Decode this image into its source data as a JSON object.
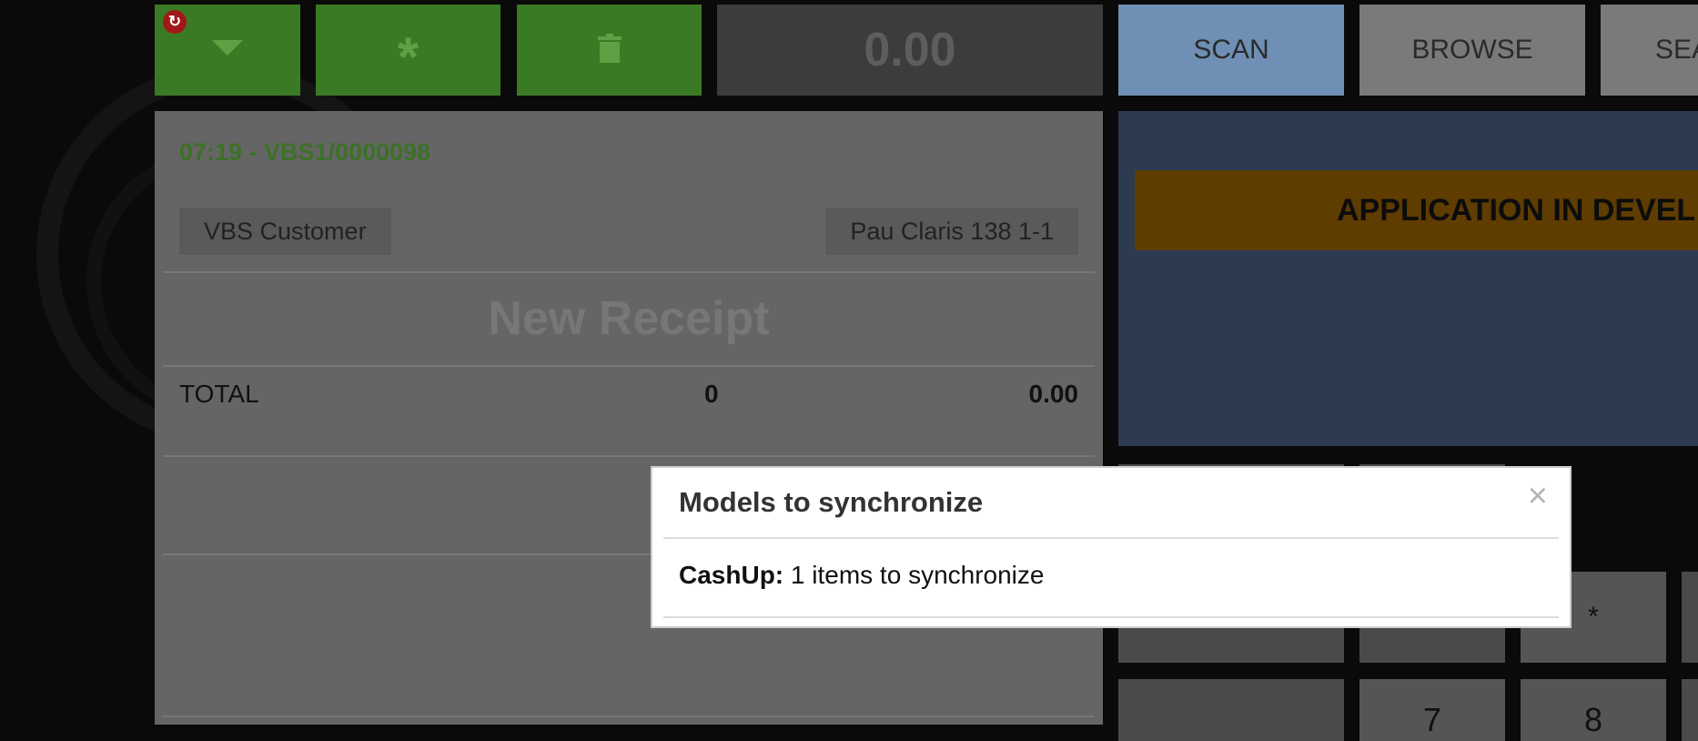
{
  "toolbar": {
    "menu_icon": "caret-down-icon",
    "sync_badge_icon": "sync-icon",
    "asterisk_label": "*",
    "delete_icon": "trash-icon",
    "amount": "0.00",
    "tabs": {
      "scan": "SCAN",
      "browse": "BROWSE",
      "search": "SEA"
    }
  },
  "receipt": {
    "header": "07:19 - VBS1/0000098",
    "customer": "VBS Customer",
    "address": "Pau Claris 138 1-1",
    "title": "New Receipt",
    "total_label": "TOTAL",
    "total_count": "0",
    "total_amount": "0.00"
  },
  "right_panel": {
    "banner": "APPLICATION IN DEVEL"
  },
  "keypad": {
    "asterisk": "*",
    "seven": "7",
    "eight": "8"
  },
  "modal": {
    "title": "Models to synchronize",
    "close": "×",
    "item_label": "CashUp:",
    "item_text": " 1 items to synchronize"
  },
  "colors": {
    "green": "#3b7a25",
    "scan_tab": "#6f8fb4",
    "dev_banner": "#5f3c00",
    "badge": "#a11818"
  }
}
